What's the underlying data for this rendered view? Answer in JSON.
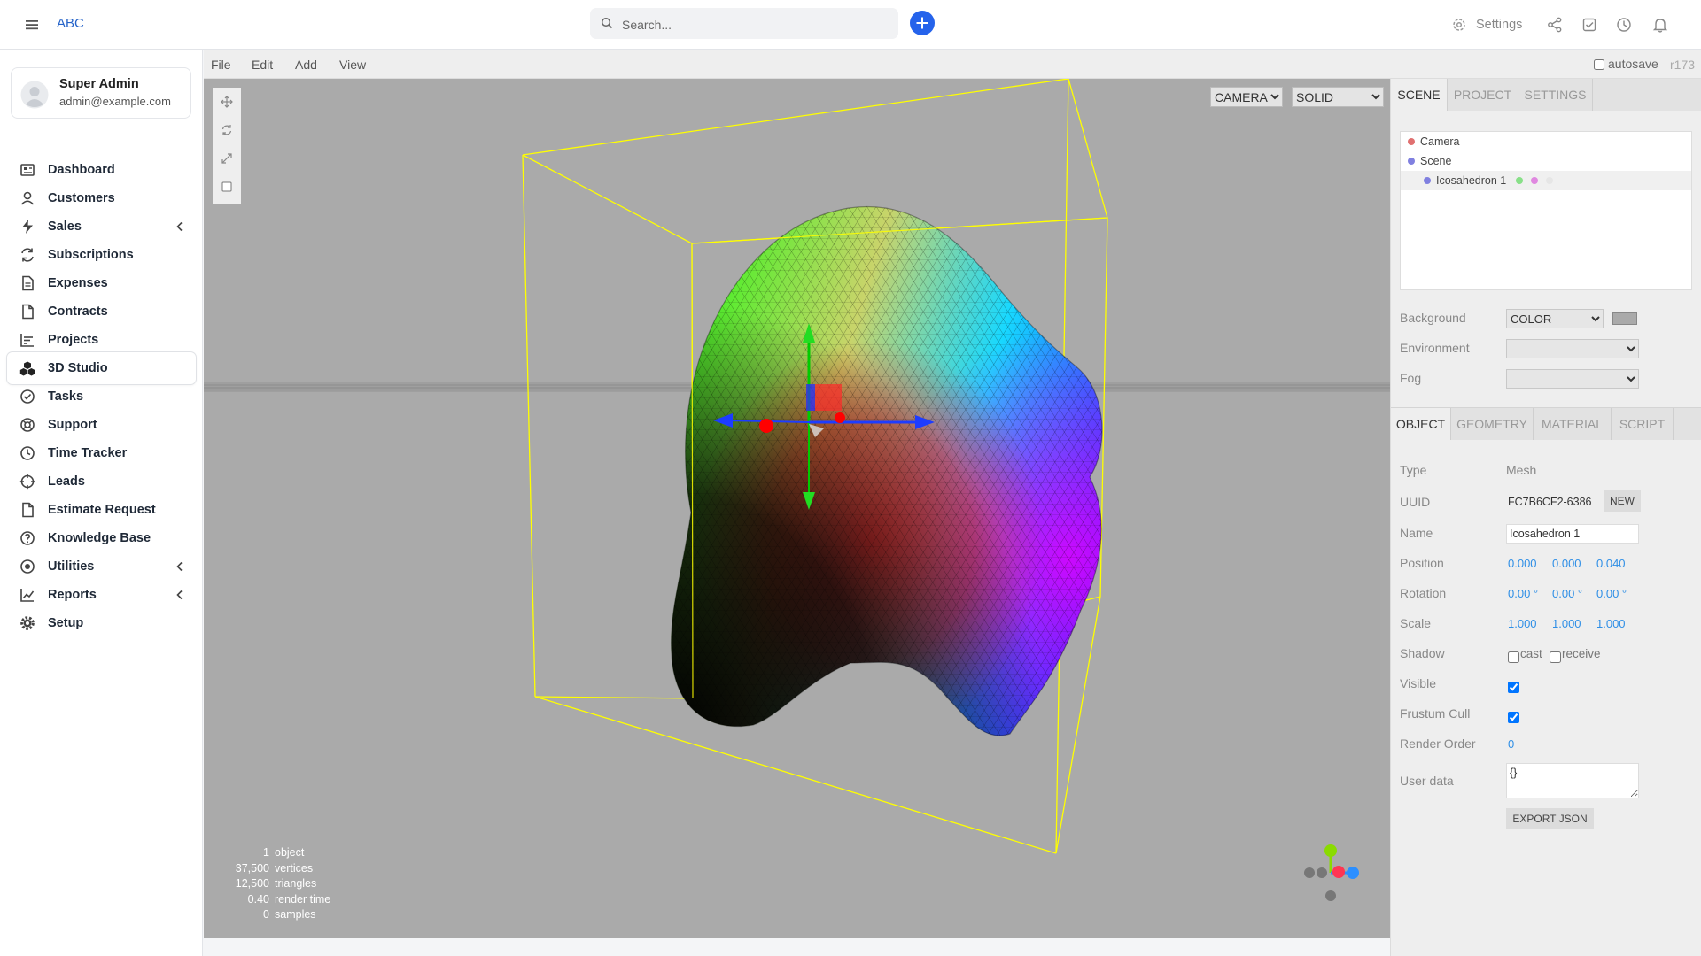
{
  "topbar": {
    "brand": "ABC",
    "search_placeholder": "Search...",
    "settings_label": "Settings",
    "icons": [
      "menu-icon",
      "search-icon",
      "plus-icon",
      "gear-icon",
      "share-icon",
      "check-square-icon",
      "clock-icon",
      "bell-icon"
    ],
    "accent_color": "#2563eb"
  },
  "user": {
    "name": "Super Admin",
    "email": "admin@example.com"
  },
  "nav": {
    "active": "3D Studio",
    "items": [
      {
        "label": "Dashboard",
        "icon": "dashboard-icon"
      },
      {
        "label": "Customers",
        "icon": "user-icon"
      },
      {
        "label": "Sales",
        "icon": "bolt-icon",
        "expandable": true
      },
      {
        "label": "Subscriptions",
        "icon": "refresh-icon"
      },
      {
        "label": "Expenses",
        "icon": "file-text-icon"
      },
      {
        "label": "Contracts",
        "icon": "file-icon"
      },
      {
        "label": "Projects",
        "icon": "bar-chart-icon"
      },
      {
        "label": "3D Studio",
        "icon": "cubes-icon"
      },
      {
        "label": "Tasks",
        "icon": "check-circle-icon"
      },
      {
        "label": "Support",
        "icon": "lifebuoy-icon"
      },
      {
        "label": "Time Tracker",
        "icon": "clock-icon"
      },
      {
        "label": "Leads",
        "icon": "crosshair-icon"
      },
      {
        "label": "Estimate Request",
        "icon": "document-icon"
      },
      {
        "label": "Knowledge Base",
        "icon": "help-circle-icon"
      },
      {
        "label": "Utilities",
        "icon": "disc-icon",
        "expandable": true
      },
      {
        "label": "Reports",
        "icon": "line-chart-icon",
        "expandable": true
      },
      {
        "label": "Setup",
        "icon": "cog-icon"
      }
    ]
  },
  "editor": {
    "menubar": {
      "file": "File",
      "edit": "Edit",
      "add": "Add",
      "view": "View",
      "autosave": "autosave",
      "revision": "r173"
    },
    "viewport": {
      "camera": "CAMERA",
      "shading": "SOLID",
      "background_color": "#aaaaaa",
      "tools": [
        "move-icon",
        "rotate-icon",
        "scale-icon",
        "local-checkbox"
      ],
      "info": [
        {
          "value": "1",
          "label": "object"
        },
        {
          "value": "37,500",
          "label": "vertices"
        },
        {
          "value": "12,500",
          "label": "triangles"
        },
        {
          "value": "0.40",
          "label": "render time"
        },
        {
          "value": "0",
          "label": "samples"
        }
      ],
      "selection_box_color": "#ffff00",
      "axis_colors": {
        "x": "#ff3653",
        "y": "#8adb00",
        "z": "#2c8fff"
      }
    },
    "panel": {
      "tabs": [
        "SCENE",
        "PROJECT",
        "SETTINGS"
      ],
      "active_tab": "SCENE",
      "outliner": [
        {
          "label": "Camera",
          "color": "#e07070",
          "indent": 0
        },
        {
          "label": "Scene",
          "color": "#8080e0",
          "indent": 0
        },
        {
          "label": "Icosahedron 1",
          "color": "#8080e0",
          "indent": 1,
          "selected": true,
          "extras": [
            "#88e088",
            "#e088e0",
            "#e6e6e6"
          ]
        }
      ],
      "scene": {
        "background_label": "Background",
        "background_type": "COLOR",
        "background_swatch": "#aaaaaa",
        "environment_label": "Environment",
        "environment_value": "",
        "fog_label": "Fog",
        "fog_value": ""
      },
      "object_tabs": [
        "OBJECT",
        "GEOMETRY",
        "MATERIAL",
        "SCRIPT"
      ],
      "active_object_tab": "OBJECT",
      "object": {
        "type_label": "Type",
        "type": "Mesh",
        "uuid_label": "UUID",
        "uuid": "FC7B6CF2-6386",
        "new_label": "NEW",
        "name_label": "Name",
        "name": "Icosahedron 1",
        "position_label": "Position",
        "position": [
          "0.000",
          "0.000",
          "0.040"
        ],
        "rotation_label": "Rotation",
        "rotation": [
          "0.00 °",
          "0.00 °",
          "0.00 °"
        ],
        "scale_label": "Scale",
        "scale": [
          "1.000",
          "1.000",
          "1.000"
        ],
        "shadow_label": "Shadow",
        "cast_label": "cast",
        "receive_label": "receive",
        "cast": false,
        "receive": false,
        "visible_label": "Visible",
        "visible": true,
        "frustum_label": "Frustum Cull",
        "frustum_cull": true,
        "render_order_label": "Render Order",
        "render_order": "0",
        "userdata_label": "User data",
        "userdata": "{}",
        "export_label": "EXPORT JSON"
      }
    }
  }
}
